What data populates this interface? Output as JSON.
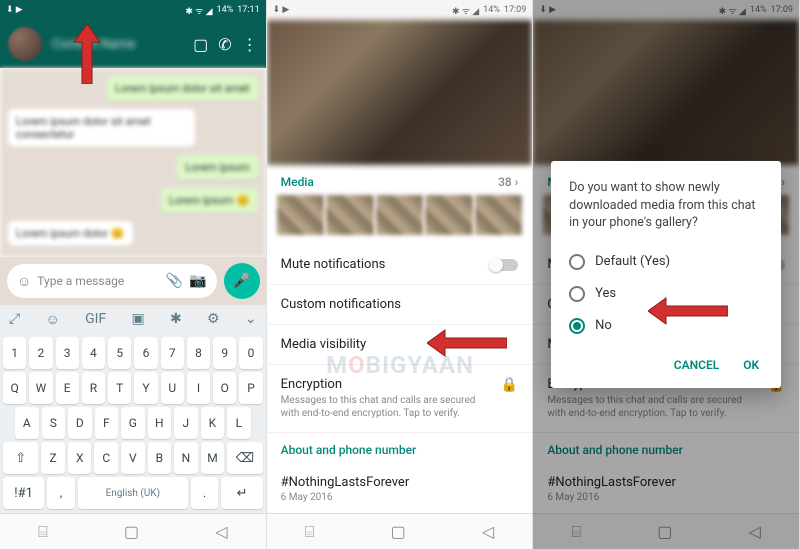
{
  "status": {
    "battery": "14%",
    "time1": "17:11",
    "time2": "17:09",
    "icons_left": "⬇ ▶",
    "icons_right": "✱ ᯤ ◢"
  },
  "chat_header": {
    "name": "Contact Name"
  },
  "input": {
    "placeholder": "Type a message"
  },
  "keyboard": {
    "row_nums": [
      "1",
      "2",
      "3",
      "4",
      "5",
      "6",
      "7",
      "8",
      "9",
      "0"
    ],
    "row1": [
      "Q",
      "W",
      "E",
      "R",
      "T",
      "Y",
      "U",
      "I",
      "O",
      "P"
    ],
    "row2": [
      "A",
      "S",
      "D",
      "F",
      "G",
      "H",
      "J",
      "K",
      "L"
    ],
    "row3_shift": "⇧",
    "row3": [
      "Z",
      "X",
      "C",
      "V",
      "B",
      "N",
      "M"
    ],
    "row3_back": "⌫",
    "row4_sym": "!#1",
    "row4_comma": ",",
    "row4_space": "English (UK)",
    "row4_period": ".",
    "row4_enter": "↵"
  },
  "contact_info": {
    "media_label": "Media",
    "media_count": "38 ›",
    "mute": "Mute notifications",
    "custom": "Custom notifications",
    "media_visibility": "Media visibility",
    "encryption_title": "Encryption",
    "encryption_sub": "Messages to this chat and calls are secured with end-to-end encryption. Tap to verify.",
    "about_header": "About and phone number",
    "about_text": "#NothingLastsForever",
    "about_date": "6 May 2016"
  },
  "dialog": {
    "title": "Do you want to show newly downloaded media from this chat in your phone's gallery?",
    "opt_default": "Default (Yes)",
    "opt_yes": "Yes",
    "opt_no": "No",
    "cancel": "CANCEL",
    "ok": "OK"
  },
  "watermark": "M BIGYAAN"
}
